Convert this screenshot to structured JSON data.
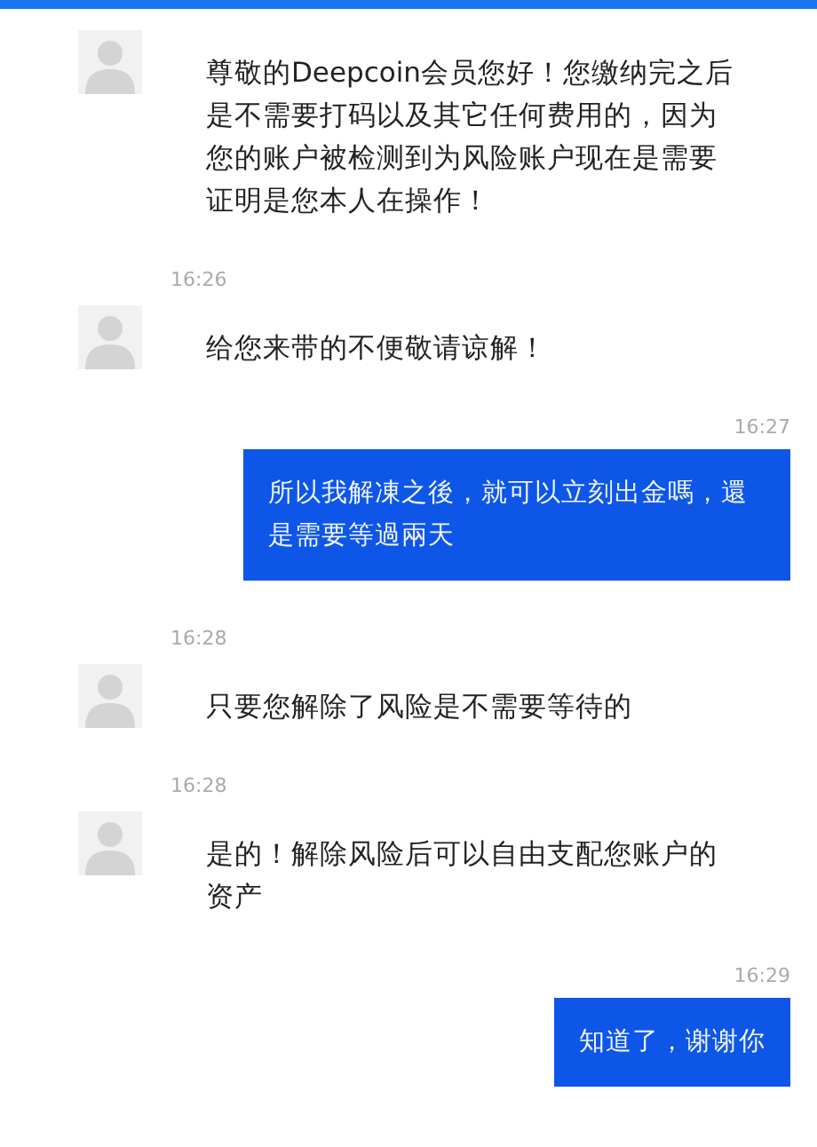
{
  "messages": [
    {
      "kind": "received",
      "text": "尊敬的Deepcoin会员您好！您缴纳完之后是不需要打码以及其它任何费用的，因为您的账户被检测到为风险账户现在是需要证明是您本人在操作！"
    },
    {
      "kind": "received",
      "time": "16:26",
      "text": "给您来带的不便敬请谅解！"
    },
    {
      "kind": "sent",
      "time": "16:27",
      "text": "所以我解凍之後，就可以立刻出金嗎，還是需要等過兩天"
    },
    {
      "kind": "received",
      "time": "16:28",
      "text": "只要您解除了风险是不需要等待的"
    },
    {
      "kind": "received",
      "time": "16:28",
      "text": "是的！解除风险后可以自由支配您账户的资产"
    },
    {
      "kind": "sent",
      "time": "16:29",
      "text": "知道了，谢谢你"
    }
  ]
}
